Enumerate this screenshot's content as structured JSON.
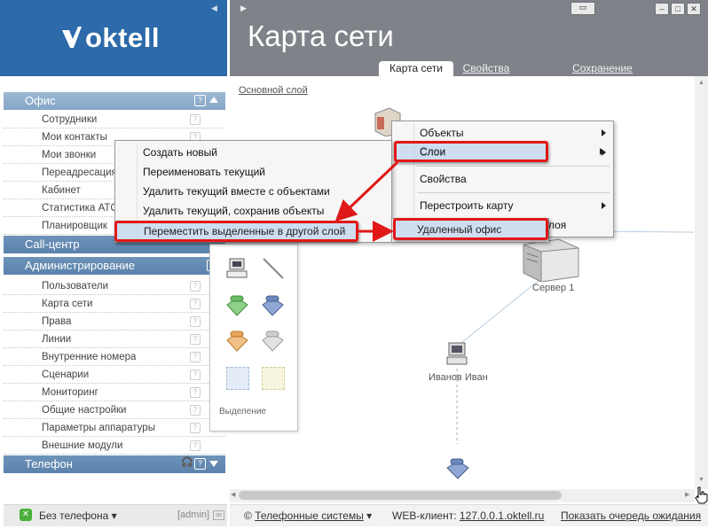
{
  "app": {
    "logo_text": "oktell",
    "page_title": "Карта сети"
  },
  "tabs": [
    {
      "label": "Карта сети",
      "active": true
    },
    {
      "label": "Свойства",
      "active": false
    },
    {
      "label": "Сохранение",
      "active": false
    }
  ],
  "sidebar": {
    "sections": [
      {
        "title": "Офис",
        "items": [
          "Сотрудники",
          "Мои контакты",
          "Мои звонки",
          "Переадресация",
          "Кабинет",
          "Статистика АТС",
          "Планировщик"
        ]
      },
      {
        "title": "Call-центр",
        "items": []
      },
      {
        "title": "Администрирование",
        "items": [
          "Пользователи",
          "Карта сети",
          "Права",
          "Линии",
          "Внутренние номера",
          "Сценарии",
          "Мониторинг",
          "Общие настройки",
          "Параметры аппаратуры",
          "Внешние модули"
        ]
      },
      {
        "title": "Телефон",
        "items": []
      }
    ],
    "help_glyph": "?"
  },
  "footer_left": {
    "phone_status": "Без телефона",
    "user": "[admin]"
  },
  "status_bar": {
    "telephony": "Телефонные системы",
    "web_client_label": "WEB-клиент:",
    "web_client_url": "127.0.0.1.oktell.ru",
    "queue_link": "Показать очередь ожидания"
  },
  "canvas": {
    "layer_link": "Основной слой",
    "nodes": [
      {
        "label": "Сервер 1",
        "type": "server"
      },
      {
        "label": "Иванов Иван",
        "type": "computer"
      }
    ]
  },
  "palette": {
    "caption": "Выделение",
    "icons": [
      "computer-icon",
      "line-icon",
      "green-phone-icon",
      "blue-phone-icon",
      "orange-phone-icon",
      "grey-phone-icon",
      "blue-selection-icon",
      "yellow-selection-icon"
    ]
  },
  "context_menu_main": {
    "items": [
      "Объекты",
      "Слои",
      "Свойства",
      "Перестроить карту",
      "лоя"
    ],
    "submenu_items": [
      true,
      true,
      false,
      true,
      false
    ]
  },
  "context_menu_layers": {
    "items": [
      "Создать новый",
      "Переименовать текущий",
      "Удалить текущий вместе с объектами",
      "Удалить текущий, сохранив объекты",
      "Переместить выделенные в другой слой"
    ]
  },
  "context_menu_target": {
    "items": [
      "Удаленный офис"
    ]
  },
  "colors": {
    "brand_blue": "#2c6aa9",
    "header_grey": "#7f8389",
    "section_blue": "#8eaccb",
    "annotation_red": "#e01818"
  }
}
